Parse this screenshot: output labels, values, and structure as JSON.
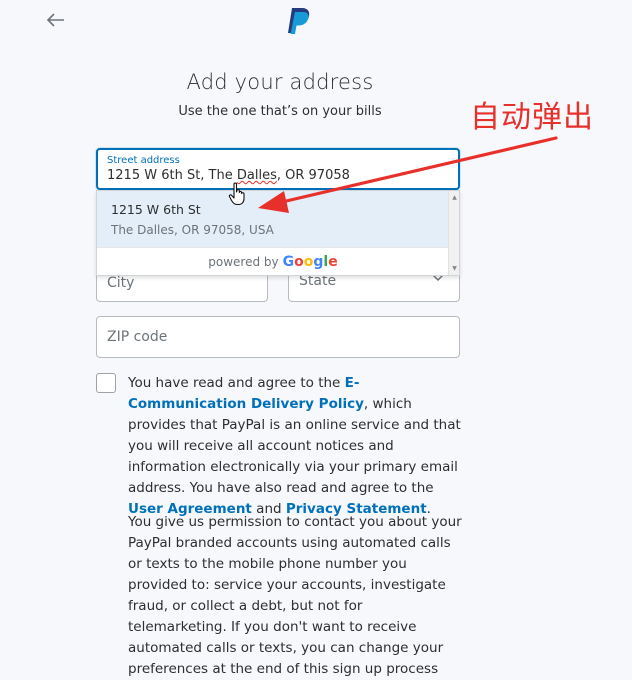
{
  "header": {
    "back_icon": "arrow-left-icon",
    "logo_icon": "paypal-logo-icon"
  },
  "page": {
    "title": "Add your address",
    "subtitle": "Use the one that’s on your bills"
  },
  "annotation": {
    "text": "自动弹出",
    "color": "#e8302b"
  },
  "form": {
    "street": {
      "label": "Street address",
      "value_before": "1215 W 6th St, The ",
      "value_misspelled": "Dalles",
      "value_after": ", OR 97058"
    },
    "suggestion": {
      "line1": "1215 W 6th St",
      "line2": "The Dalles, OR 97058, USA"
    },
    "powered_by": "powered by",
    "google": [
      "G",
      "o",
      "o",
      "g",
      "l",
      "e"
    ],
    "city_placeholder": "City",
    "state_placeholder": "State",
    "zip_placeholder": "ZIP code"
  },
  "consent": {
    "part1": "You have read and agree to the ",
    "link_ecomm": "E-Communication Delivery Policy",
    "part2": ", which provides that PayPal is an online service and that you will receive all account notices and information electronically via your primary email address. You have also read and agree to the ",
    "link_user_agreement": "User Agreement",
    "part3": " and ",
    "link_privacy": "Privacy Statement",
    "part4": "."
  },
  "permission_text": "You give us permission to contact you about your PayPal branded accounts using automated calls or texts to the mobile phone number you provided to: service your accounts, investigate fraud, or collect a debt, but not for telemarketing. If you don't want to receive automated calls or texts, you can change your preferences at the end of this sign up process",
  "colors": {
    "accent": "#0070ba",
    "annotation": "#e8302b",
    "background": "#f7f8fb"
  }
}
